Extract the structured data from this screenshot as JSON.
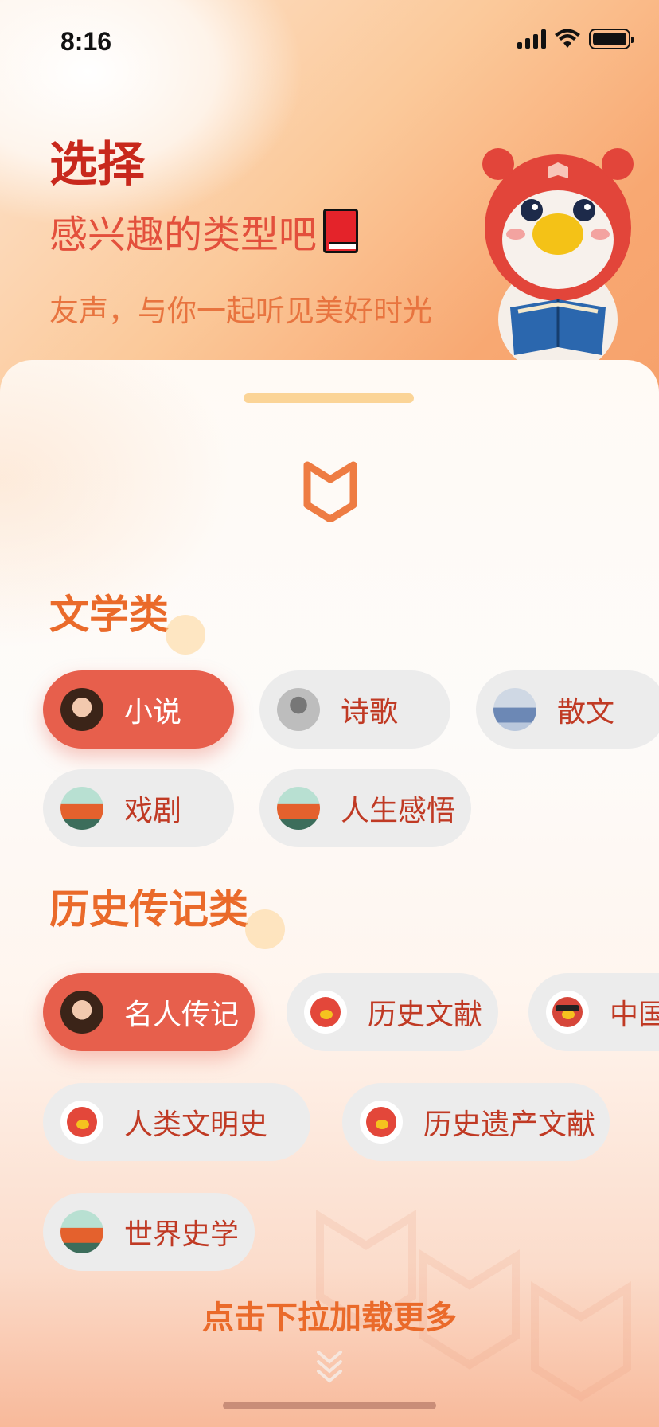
{
  "status_bar": {
    "time": "8:16"
  },
  "hero": {
    "title": "选择",
    "subtitle": "感兴趣的类型吧",
    "tagline": "友声，与你一起听见美好时光"
  },
  "sections": [
    {
      "title": "文学类",
      "chips": [
        {
          "label": "小说",
          "selected": true,
          "avatar": "woman-portrait"
        },
        {
          "label": "诗歌",
          "selected": false,
          "avatar": "bw-portrait"
        },
        {
          "label": "散文",
          "selected": false,
          "avatar": "beach-photo"
        },
        {
          "label": "戏剧",
          "selected": false,
          "avatar": "bus-photo"
        },
        {
          "label": "人生感悟",
          "selected": false,
          "avatar": "bus-photo"
        }
      ]
    },
    {
      "title": "历史传记类",
      "chips": [
        {
          "label": "名人传记",
          "selected": true,
          "avatar": "woman-portrait"
        },
        {
          "label": "历史文献",
          "selected": false,
          "avatar": "mascot"
        },
        {
          "label": "中国",
          "selected": false,
          "avatar": "mascot-sunglasses"
        },
        {
          "label": "人类文明史",
          "selected": false,
          "avatar": "mascot"
        },
        {
          "label": "历史遗产文献",
          "selected": false,
          "avatar": "mascot-reading"
        },
        {
          "label": "世界史学",
          "selected": false,
          "avatar": "bus-photo"
        }
      ]
    }
  ],
  "footer": {
    "load_more": "点击下拉加载更多"
  },
  "colors": {
    "accent": "#e75f4c",
    "title_red": "#c8281c",
    "section_orange": "#ea6a2a",
    "chip_bg": "#ececec"
  }
}
